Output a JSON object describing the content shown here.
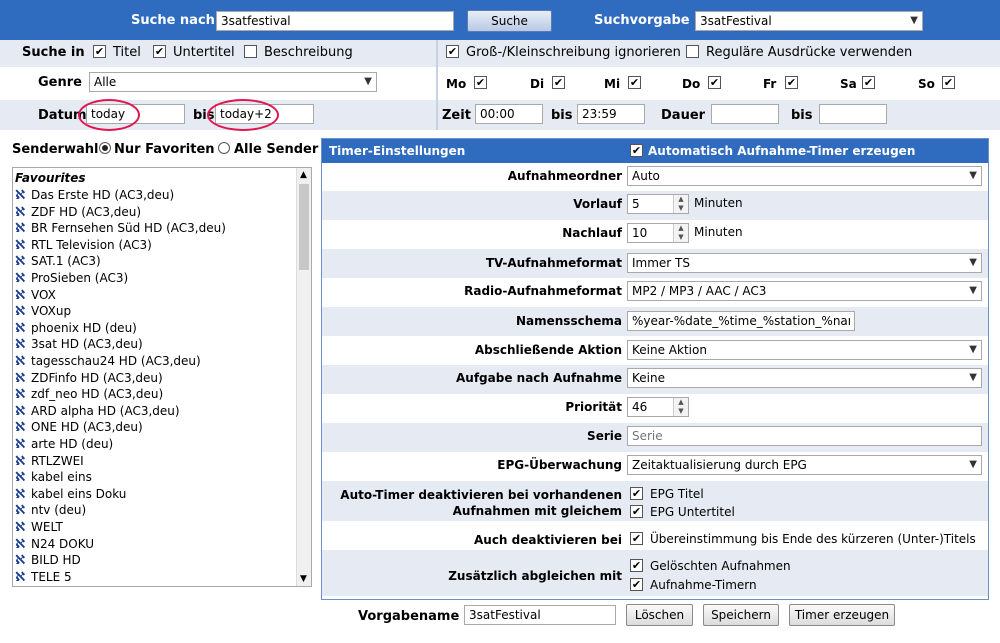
{
  "topbar": {
    "search_label": "Suche nach",
    "search_value": "3satfestival",
    "search_button": "Suche",
    "preset_label": "Suchvorgabe",
    "preset_value": "3satFestival"
  },
  "search_in": {
    "label": "Suche in",
    "title": "Titel",
    "subtitle": "Untertitel",
    "description": "Beschreibung",
    "ignore_case": "Groß-/Kleinschreibung ignorieren",
    "regex": "Reguläre Ausdrücke verwenden"
  },
  "genre": {
    "label": "Genre",
    "value": "Alle"
  },
  "days": [
    {
      "label": "Mo"
    },
    {
      "label": "Di"
    },
    {
      "label": "Mi"
    },
    {
      "label": "Do"
    },
    {
      "label": "Fr"
    },
    {
      "label": "Sa"
    },
    {
      "label": "So"
    }
  ],
  "date": {
    "label": "Datum",
    "from": "today",
    "to_label": "bis",
    "to": "today+2"
  },
  "time": {
    "label": "Zeit",
    "from": "00:00",
    "to_label": "bis",
    "to": "23:59",
    "duration_label": "Dauer",
    "duration_to_label": "bis"
  },
  "channels": {
    "label": "Senderwahl",
    "opt_fav": "Nur Favoriten",
    "opt_all": "Alle Sender",
    "group": "Favourites",
    "items": [
      "Das Erste HD (AC3,deu)",
      "ZDF HD (AC3,deu)",
      "BR Fernsehen Süd HD (AC3,deu)",
      "RTL Television (AC3)",
      "SAT.1 (AC3)",
      "ProSieben (AC3)",
      "VOX",
      "VOXup",
      "phoenix HD (deu)",
      "3sat HD (AC3,deu)",
      "tagesschau24 HD (AC3,deu)",
      "ZDFinfo HD (AC3,deu)",
      "zdf_neo HD (AC3,deu)",
      "ARD alpha HD (AC3,deu)",
      "ONE HD (AC3,deu)",
      "arte HD (deu)",
      "RTLZWEI",
      "kabel eins",
      "kabel eins Doku",
      "ntv (deu)",
      "WELT",
      "N24 DOKU",
      "BILD HD",
      "TELE 5"
    ]
  },
  "timer": {
    "header": "Timer-Einstellungen",
    "auto_label": "Automatisch Aufnahme-Timer erzeugen",
    "folder_label": "Aufnahmeordner",
    "folder_value": "Auto",
    "pre_label": "Vorlauf",
    "pre_value": "5",
    "pre_unit": "Minuten",
    "post_label": "Nachlauf",
    "post_value": "10",
    "post_unit": "Minuten",
    "tv_label": "TV-Aufnahmeformat",
    "tv_value": "Immer TS",
    "radio_label": "Radio-Aufnahmeformat",
    "radio_value": "MP2 / MP3 / AAC / AC3",
    "name_label": "Namensschema",
    "name_value": "%year-%date_%time_%station_%name",
    "final_label": "Abschließende Aktion",
    "final_value": "Keine Aktion",
    "task_label": "Aufgabe nach Aufnahme",
    "task_value": "Keine",
    "prio_label": "Priorität",
    "prio_value": "46",
    "series_label": "Serie",
    "series_placeholder": "Serie",
    "epg_label": "EPG-Überwachung",
    "epg_value": "Zeitaktualisierung durch EPG",
    "deact_label_1": "Auto-Timer deaktivieren bei vorhandenen",
    "deact_label_2": "Aufnahmen mit gleichem",
    "deact_epg_title": "EPG Titel",
    "deact_epg_sub": "EPG Untertitel",
    "also_label": "Auch deaktivieren bei",
    "also_value": "Übereinstimmung bis Ende des kürzeren (Unter-)Titels",
    "extra_label": "Zusätzlich abgleichen mit",
    "extra_deleted": "Gelöschten Aufnahmen",
    "extra_timers": "Aufnahme-Timern"
  },
  "footer": {
    "name_label": "Vorgabename",
    "name_value": "3satFestival",
    "delete": "Löschen",
    "save": "Speichern",
    "create": "Timer erzeugen"
  },
  "colors": {
    "header_blue": "#2f6bbf",
    "row_alt": "#e5eaf3",
    "highlight": "#e0174f"
  }
}
